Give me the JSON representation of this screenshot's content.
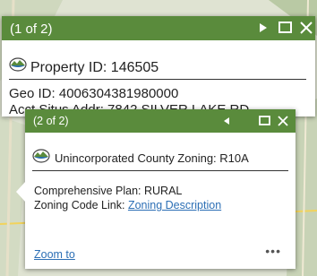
{
  "popup1": {
    "count": "(1 of 2)",
    "title": "Property ID: 146505",
    "fields": [
      "Geo ID: 4006304381980000",
      "Acct Situs Addr: 7842 SILVER LAKE RD"
    ],
    "icons": [
      "next-icon",
      "maximize-icon",
      "close-icon",
      "layer-icon"
    ]
  },
  "popup2": {
    "count": "(2 of 2)",
    "title": "Unincorporated County Zoning: R10A",
    "comp_label": "Comprehensive Plan:",
    "comp_value": "RURAL",
    "zoning_label": "Zoning Code Link:",
    "zoning_link": "Zoning Description",
    "zoom_to": "Zoom to",
    "more": "•••",
    "icons": [
      "previous-icon",
      "maximize-icon",
      "close-icon",
      "layer-icon"
    ]
  },
  "colors": {
    "header": "#5a8b3c",
    "link": "#2c6fb5"
  }
}
